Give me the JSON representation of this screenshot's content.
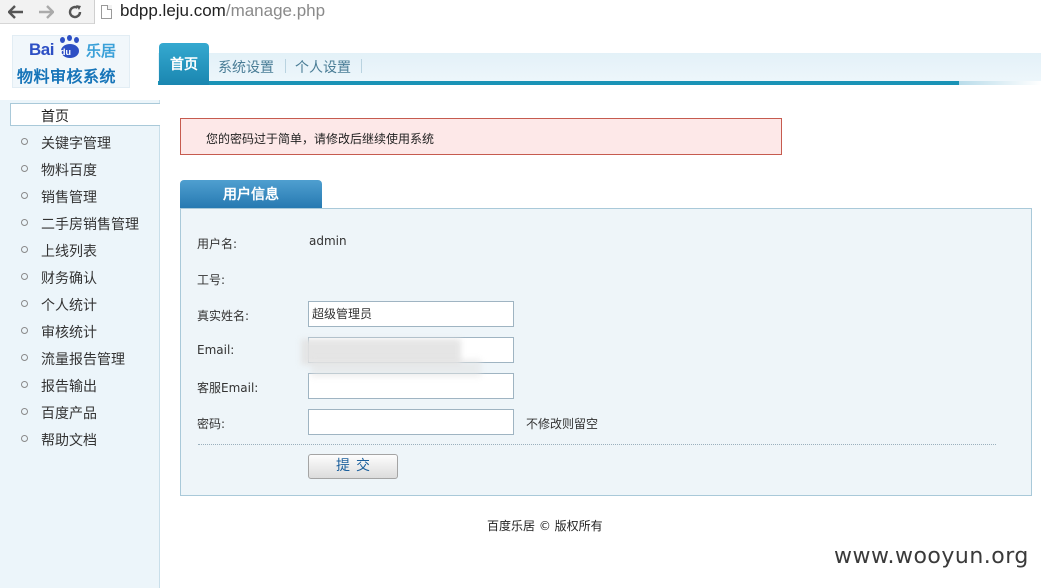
{
  "browser": {
    "url_host": "bdpp.leju.com",
    "url_path": "/manage.php"
  },
  "logo": {
    "brand_latin": "Bai",
    "brand_du": "du",
    "brand_partner": "乐居",
    "system_name": "物料审核系统"
  },
  "top_tabs": [
    {
      "label": "首页",
      "active": true
    },
    {
      "label": "系统设置",
      "active": false
    },
    {
      "label": "个人设置",
      "active": false
    }
  ],
  "sidebar": {
    "active_item": "首页",
    "items": [
      "关键字管理",
      "物料百度",
      "销售管理",
      "二手房销售管理",
      "上线列表",
      "财务确认",
      "个人统计",
      "审核统计",
      "流量报告管理",
      "报告输出",
      "百度产品",
      "帮助文档"
    ]
  },
  "alert": {
    "message": "您的密码过于简单，请修改后继续使用系统"
  },
  "user_info": {
    "tab_title": "用户信息",
    "username_label": "用户名:",
    "username_value": "admin",
    "employee_id_label": "工号:",
    "realname_label": "真实姓名:",
    "realname_value": "超级管理员",
    "email_label": "Email:",
    "service_email_label": "客服Email:",
    "password_label": "密码:",
    "password_hint": "不修改则留空",
    "submit_label": "提交"
  },
  "footer": {
    "copyright": "百度乐居 © 版权所有"
  },
  "watermark": "www.wooyun.org",
  "colors": {
    "accent": "#1a93b6",
    "tab_blue": "#2578b0",
    "alert_border": "#c65b4f",
    "alert_bg": "#fde8e8",
    "panel_bg": "#eef5f9"
  }
}
